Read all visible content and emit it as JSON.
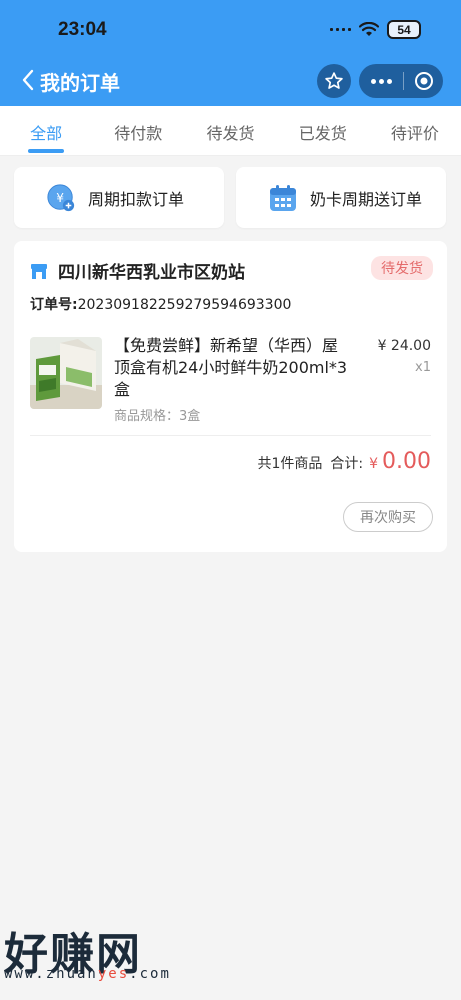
{
  "status_bar": {
    "time": "23:04",
    "battery": "54"
  },
  "nav": {
    "title": "我的订单",
    "back_icon": "chevron-left-icon",
    "star_icon": "star-icon",
    "more_icon": "more-dots-icon",
    "close_icon": "target-circle-icon"
  },
  "tabs": [
    {
      "label": "全部",
      "active": true
    },
    {
      "label": "待付款",
      "active": false
    },
    {
      "label": "待发货",
      "active": false
    },
    {
      "label": "已发货",
      "active": false
    },
    {
      "label": "待评价",
      "active": false
    }
  ],
  "quick": {
    "left": {
      "label": "周期扣款订单",
      "icon": "yen-coin-icon"
    },
    "right": {
      "label": "奶卡周期送订单",
      "icon": "calendar-icon"
    }
  },
  "order": {
    "store_name": "四川新华西乳业市区奶站",
    "store_icon": "store-icon",
    "status": "待发货",
    "order_no_label": "订单号:",
    "order_no": "20230918225927959469330​0",
    "product": {
      "title": "【免费尝鲜】新希望（华西）屋顶盒有机24小时鲜牛奶200ml*3盒",
      "spec": "商品规格：3盒",
      "price": "¥ 24.00",
      "qty": "x1"
    },
    "total_count": "共1件商品",
    "total_label": "合计:",
    "total_currency": "¥",
    "total_amount": "0.00",
    "rebuy_label": "再次购买"
  },
  "watermark": {
    "title": "好赚网",
    "url_pre": "www.zhuan",
    "url_hl": "yes",
    "url_post": ".com"
  },
  "colors": {
    "primary": "#3b9cf4",
    "price_red": "#e45b5b",
    "badge_bg": "#fde3e3"
  }
}
